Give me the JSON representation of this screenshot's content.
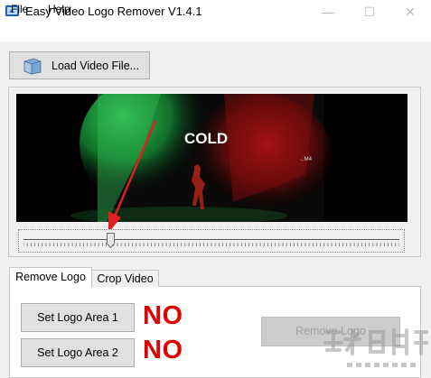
{
  "window": {
    "title": "Easy Video Logo Remover V1.4.1",
    "controls": {
      "minimize": "—",
      "maximize": "☐",
      "close": "✕"
    }
  },
  "menu": {
    "file": "File",
    "help": "Help"
  },
  "toolbar": {
    "load_label": "Load Video File...",
    "load_icon": "folder-icon"
  },
  "video": {
    "overlay_text": "COLD",
    "small_text": "⸜:M4",
    "colors": {
      "green": "#1fb64a",
      "red": "#c41414",
      "background": "#000000"
    }
  },
  "slider": {
    "position_fraction": 0.23
  },
  "tabs": [
    {
      "label": "Remove Logo",
      "active": true
    },
    {
      "label": "Crop Video",
      "active": false
    }
  ],
  "logo_areas": [
    {
      "button_label": "Set Logo Area 1",
      "status": "NO"
    },
    {
      "button_label": "Set Logo Area 2",
      "status": "NO"
    }
  ],
  "remove_logo": {
    "label": "Remove Logo",
    "enabled": false
  },
  "colors": {
    "status_red": "#e00000",
    "annotation_arrow": "#e02020"
  }
}
